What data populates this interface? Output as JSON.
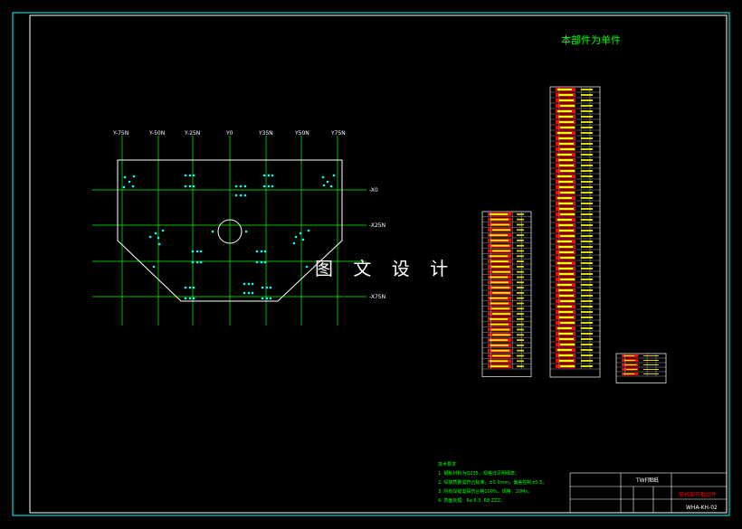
{
  "drawing": {
    "header_note": "本部件为单件",
    "watermark": "图 文 设 计",
    "colors": {
      "background": "#000000",
      "frame": "#00ffff",
      "grid": "#00ff00",
      "outline": "#ffffff",
      "hole": "#00ffff",
      "table_text": "#ffff00",
      "table_fill": "#ff0000",
      "notes": "#00ff00"
    }
  },
  "plan": {
    "column_labels": [
      "Y-75N",
      "Y-50N",
      "Y-25N",
      "Y0",
      "Y35N",
      "Y50N",
      "Y75N"
    ],
    "row_labels": [
      "-X0",
      "-X25N",
      "-X75N"
    ]
  },
  "tables": {
    "parts_list_left_rows": 30,
    "parts_list_middle_rows": 52,
    "parts_list_small_rows": 5
  },
  "notes": {
    "title": "技术要求",
    "lines": [
      "1. 钢板材料为Q235，规格详见明细表。",
      "2. 焊接质量需符合标准，±0.5mm，偏差控制±0.5。",
      "3. 所有焊缝需探伤合格100%，规格：20Mn。",
      "4. 表面处理：Ra 6.3, R8 ZZZ。"
    ]
  },
  "title_block": {
    "stamp_label": "TWF图纸",
    "drawing_name": "前机架布板组件",
    "drawing_number": "WHA-KH-02"
  }
}
